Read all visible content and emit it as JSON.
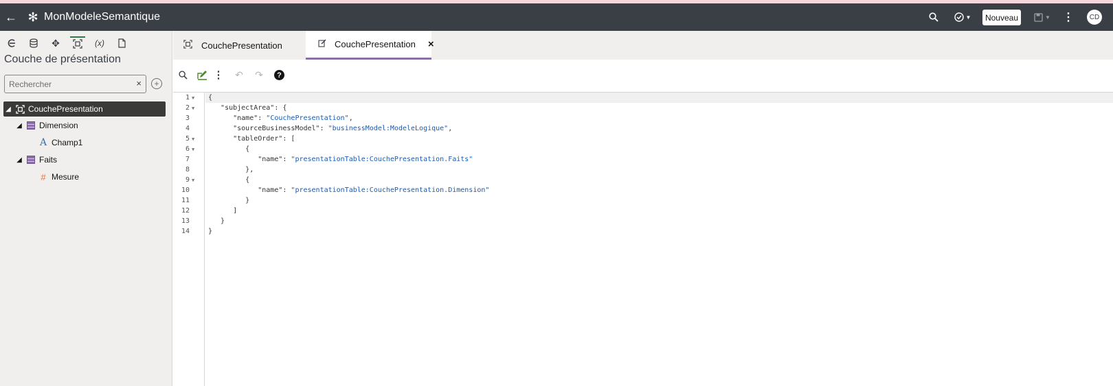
{
  "app": {
    "title": "MonModeleSemantique",
    "new_button": "Nouveau",
    "avatar": "CD"
  },
  "sidebar": {
    "heading": "Couche de présentation",
    "search_placeholder": "Rechercher",
    "search_clear": "×",
    "tree": [
      {
        "label": "CouchePresentation",
        "icon": "subject-area-icon",
        "expanded": true,
        "selected": true
      },
      {
        "label": "Dimension",
        "icon": "table-icon",
        "expanded": true
      },
      {
        "label": "Champ1",
        "icon": "text-column-icon"
      },
      {
        "label": "Faits",
        "icon": "table-icon",
        "expanded": true
      },
      {
        "label": "Mesure",
        "icon": "measure-icon"
      }
    ]
  },
  "tabs": [
    {
      "label": "CouchePresentation",
      "icon": "subject-area-icon",
      "active": false
    },
    {
      "label": "CouchePresentation",
      "icon": "edit-icon",
      "active": true,
      "close": "×"
    }
  ],
  "editor": {
    "line_numbers": [
      "1",
      "2",
      "3",
      "4",
      "5",
      "6",
      "7",
      "8",
      "9",
      "10",
      "11",
      "12",
      "13",
      "14"
    ],
    "code": [
      {
        "pre": "{",
        "str": "",
        "post": ""
      },
      {
        "pre": "   \"subjectArea\": {",
        "str": "",
        "post": ""
      },
      {
        "pre": "      \"name\": ",
        "str": "\"CouchePresentation\"",
        "post": ","
      },
      {
        "pre": "      \"sourceBusinessModel\": ",
        "str": "\"businessModel:ModeleLogique\"",
        "post": ","
      },
      {
        "pre": "      \"tableOrder\": [",
        "str": "",
        "post": ""
      },
      {
        "pre": "         {",
        "str": "",
        "post": ""
      },
      {
        "pre": "            \"name\": ",
        "str": "\"presentationTable:CouchePresentation.Faits\"",
        "post": ""
      },
      {
        "pre": "         },",
        "str": "",
        "post": ""
      },
      {
        "pre": "         {",
        "str": "",
        "post": ""
      },
      {
        "pre": "            \"name\": ",
        "str": "\"presentationTable:CouchePresentation.Dimension\"",
        "post": ""
      },
      {
        "pre": "         }",
        "str": "",
        "post": ""
      },
      {
        "pre": "      ]",
        "str": "",
        "post": ""
      },
      {
        "pre": "   }",
        "str": "",
        "post": ""
      },
      {
        "pre": "}",
        "str": "",
        "post": ""
      }
    ]
  },
  "colors": {
    "topbar": "#3a3f46",
    "selected_node": "#3a3a38",
    "active_tab_underline": "#8a6fa8",
    "string": "#1a5bb3"
  }
}
